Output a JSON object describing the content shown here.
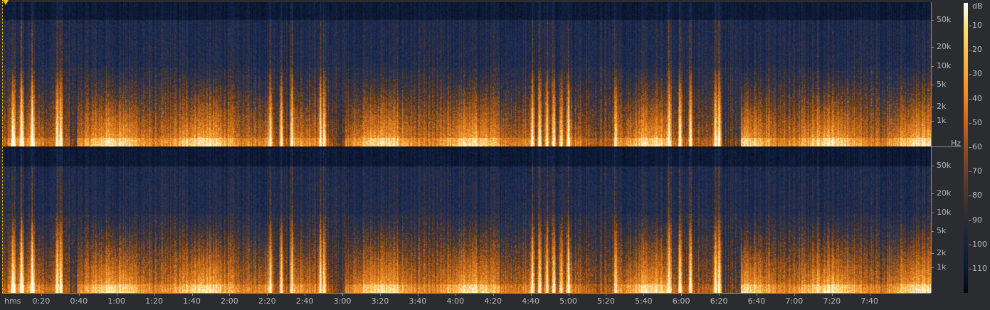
{
  "view": "spectral-frequency-display",
  "channels": 2,
  "frequency_axis": {
    "unit": "Hz",
    "labels": [
      "50k",
      "20k",
      "10k",
      "5k",
      "2k",
      "1k"
    ]
  },
  "amplitude_scale": {
    "unit": "dB",
    "labels": [
      "10",
      "20",
      "30",
      "40",
      "50",
      "60",
      "70",
      "80",
      "90",
      "100",
      "110"
    ],
    "colors": [
      "#ffffff",
      "#ffe27a",
      "#f08a1c",
      "#8a4a20",
      "#1c2444",
      "#05070e"
    ]
  },
  "time_axis": {
    "unit": "hms",
    "labels": [
      "0:20",
      "0:40",
      "1:00",
      "1:20",
      "1:40",
      "2:00",
      "2:20",
      "2:40",
      "3:00",
      "3:20",
      "3:40",
      "4:00",
      "4:20",
      "4:40",
      "5:00",
      "5:20",
      "5:40",
      "6:00",
      "6:20",
      "6:40",
      "7:00",
      "7:20",
      "7:40"
    ]
  },
  "playhead_color": "#f2c21b"
}
